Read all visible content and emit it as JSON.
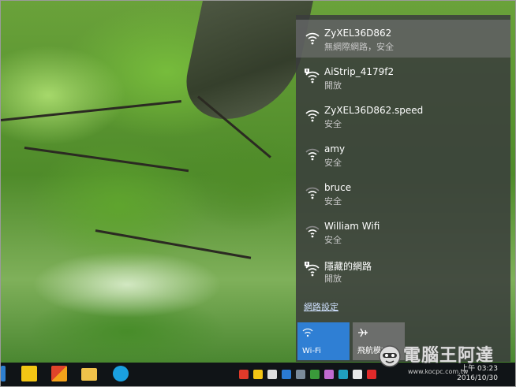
{
  "network_flyout": {
    "networks": [
      {
        "name": "ZyXEL36D862",
        "status": "無網際網路，安全",
        "secured": true,
        "selected": true
      },
      {
        "name": "AiStrip_4179f2",
        "status": "開放",
        "secured": false,
        "selected": false
      },
      {
        "name": "ZyXEL36D862.speed",
        "status": "安全",
        "secured": true,
        "selected": false
      },
      {
        "name": "amy",
        "status": "安全",
        "secured": true,
        "selected": false
      },
      {
        "name": "bruce",
        "status": "安全",
        "secured": true,
        "selected": false
      },
      {
        "name": "William Wifi",
        "status": "安全",
        "secured": true,
        "selected": false
      },
      {
        "name": "隱藏的網路",
        "status": "開放",
        "secured": false,
        "selected": false
      }
    ],
    "settings_link": "網路設定",
    "quick_actions": {
      "wifi_label": "Wi-Fi",
      "airplane_label": "飛航模式"
    }
  },
  "taskbar": {
    "clock_time": "上午 03:23",
    "clock_date": "2016/10/30",
    "apps": [
      "sticky-note-icon",
      "grid-app-icon",
      "file-explorer-icon",
      "skype-icon"
    ]
  },
  "watermark": {
    "title": "電腦王阿達",
    "url": "www.kocpc.com.tw"
  },
  "colors": {
    "flyout_bg": "#3a3c3c",
    "wifi_tile": "#2f7fd4",
    "link": "#cfe0ff"
  }
}
